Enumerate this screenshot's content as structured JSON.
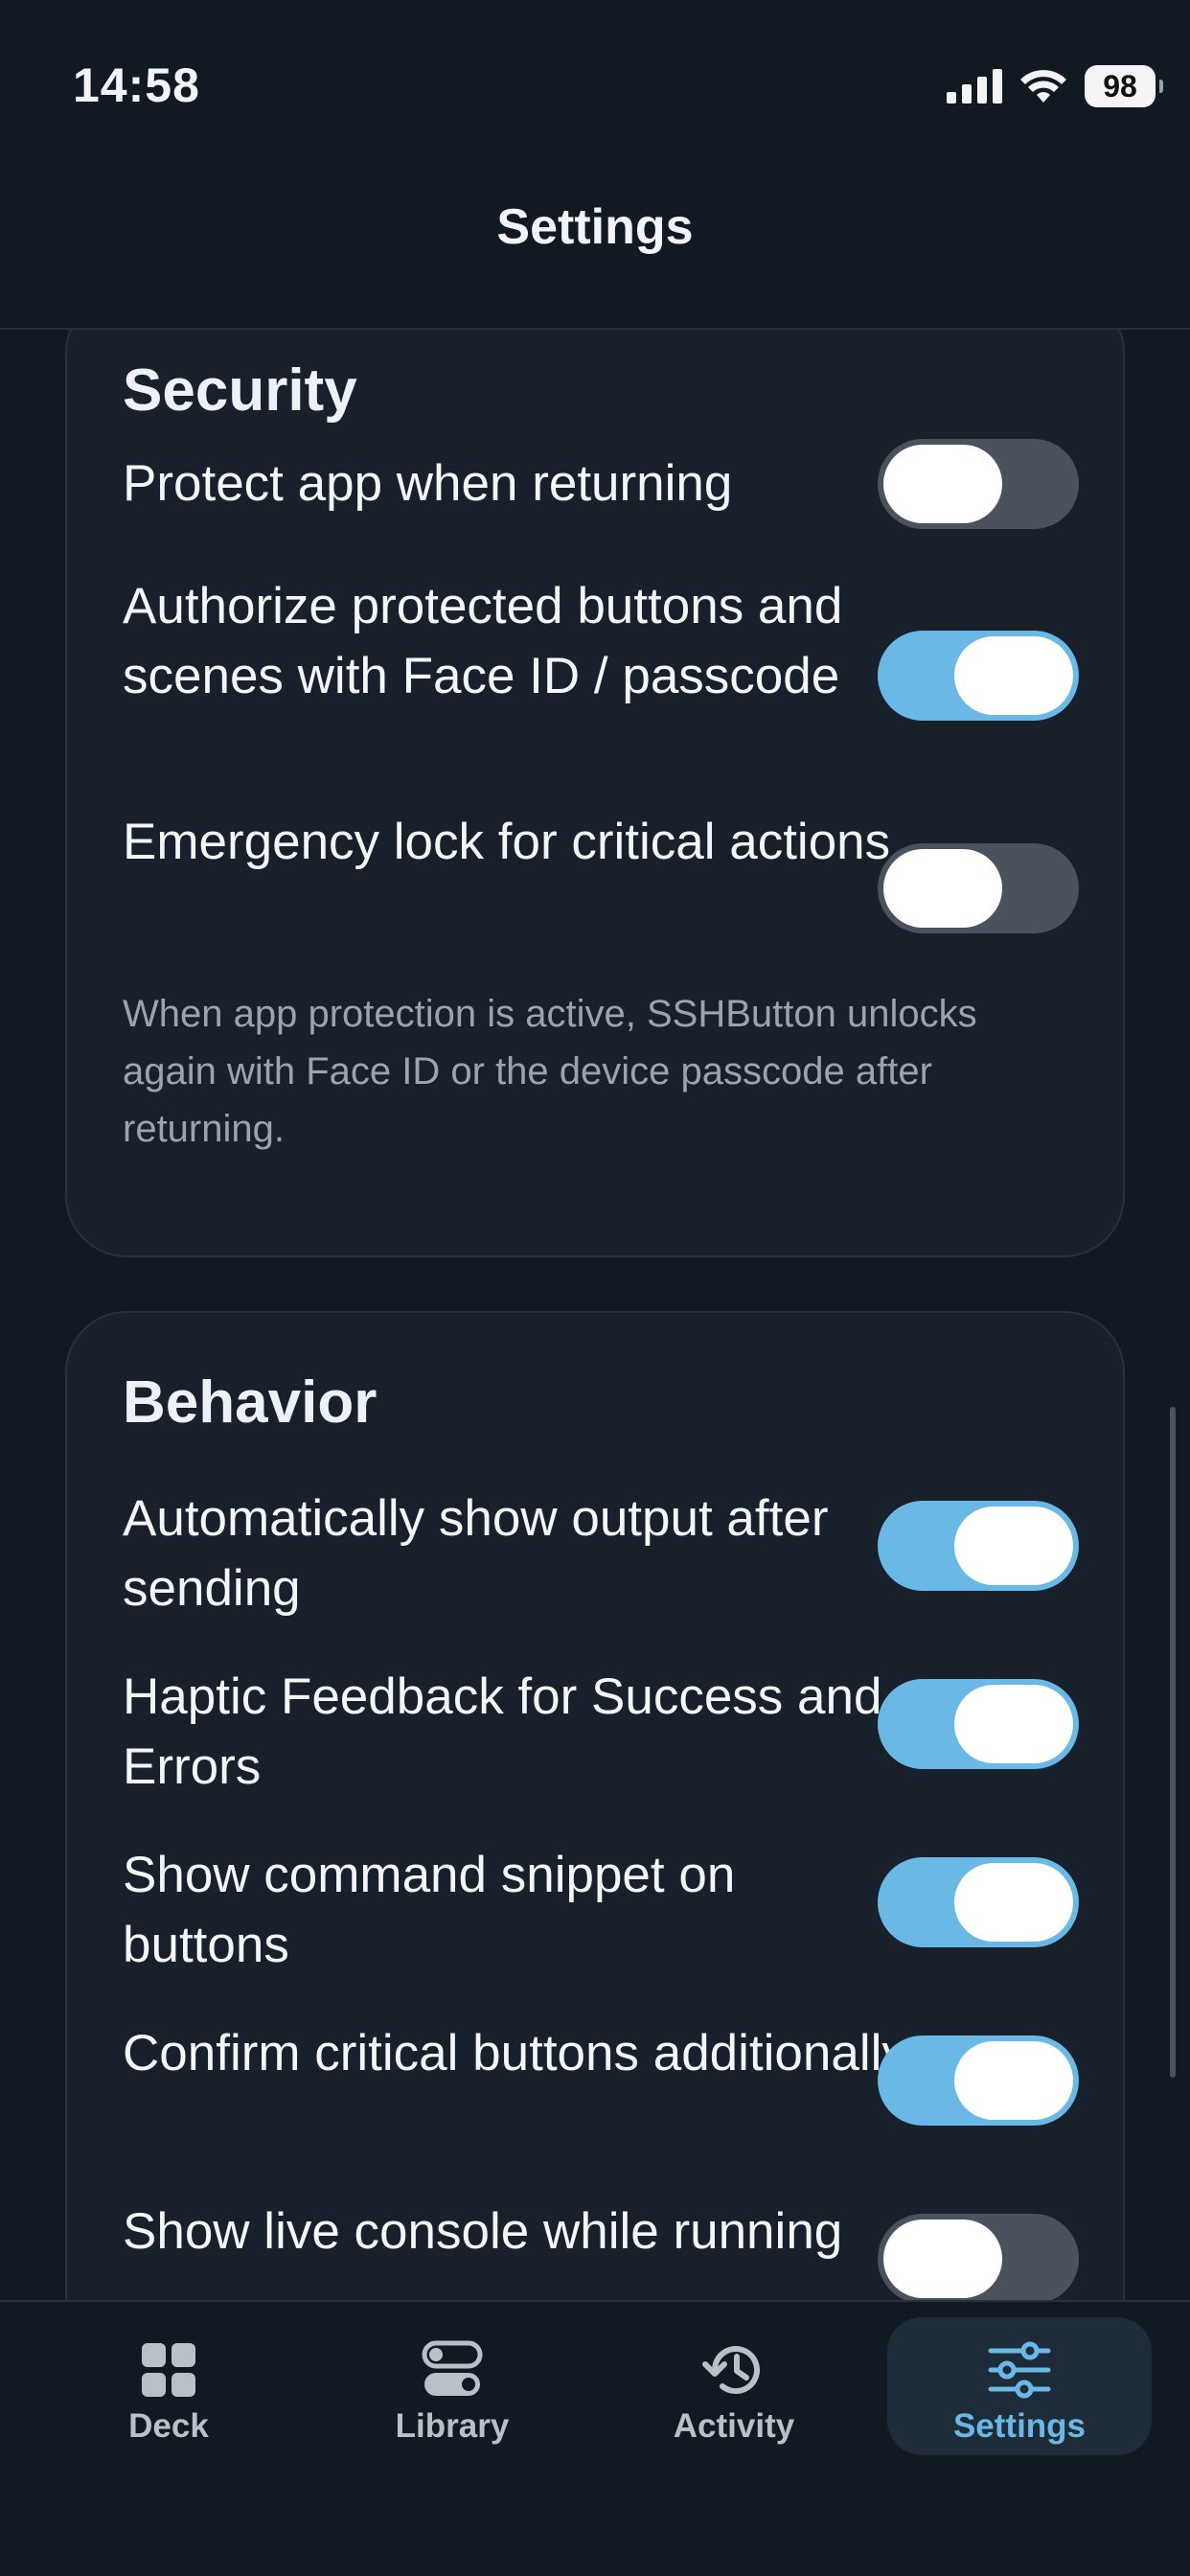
{
  "status_bar": {
    "time": "14:58",
    "battery": "98"
  },
  "nav": {
    "title": "Settings"
  },
  "security": {
    "title": "Security",
    "rows": [
      {
        "label": "Protect app when returning",
        "on": false
      },
      {
        "label": "Authorize protected buttons and scenes with Face ID / passcode",
        "on": true
      },
      {
        "label": "Emergency lock for critical actions",
        "on": false
      }
    ],
    "note": "When app protection is active, SSHButton unlocks again with Face ID or the device passcode after returning."
  },
  "behavior": {
    "title": "Behavior",
    "rows": [
      {
        "label": "Automatically show output after sending",
        "on": true
      },
      {
        "label": "Haptic Feedback for Success and Errors",
        "on": true
      },
      {
        "label": "Show command snippet on buttons",
        "on": true
      },
      {
        "label": "Confirm critical buttons additionally",
        "on": true
      },
      {
        "label": "Show live console while running",
        "on": false
      }
    ]
  },
  "tabs": [
    {
      "label": "Deck",
      "icon": "grid-icon"
    },
    {
      "label": "Library",
      "icon": "toggles-icon"
    },
    {
      "label": "Activity",
      "icon": "history-icon"
    },
    {
      "label": "Settings",
      "icon": "sliders-icon",
      "active": true
    }
  ],
  "colors": {
    "accent": "#69b8e6",
    "background": "#111a22",
    "card": "#18212b",
    "toggle_off": "#4a535d"
  }
}
